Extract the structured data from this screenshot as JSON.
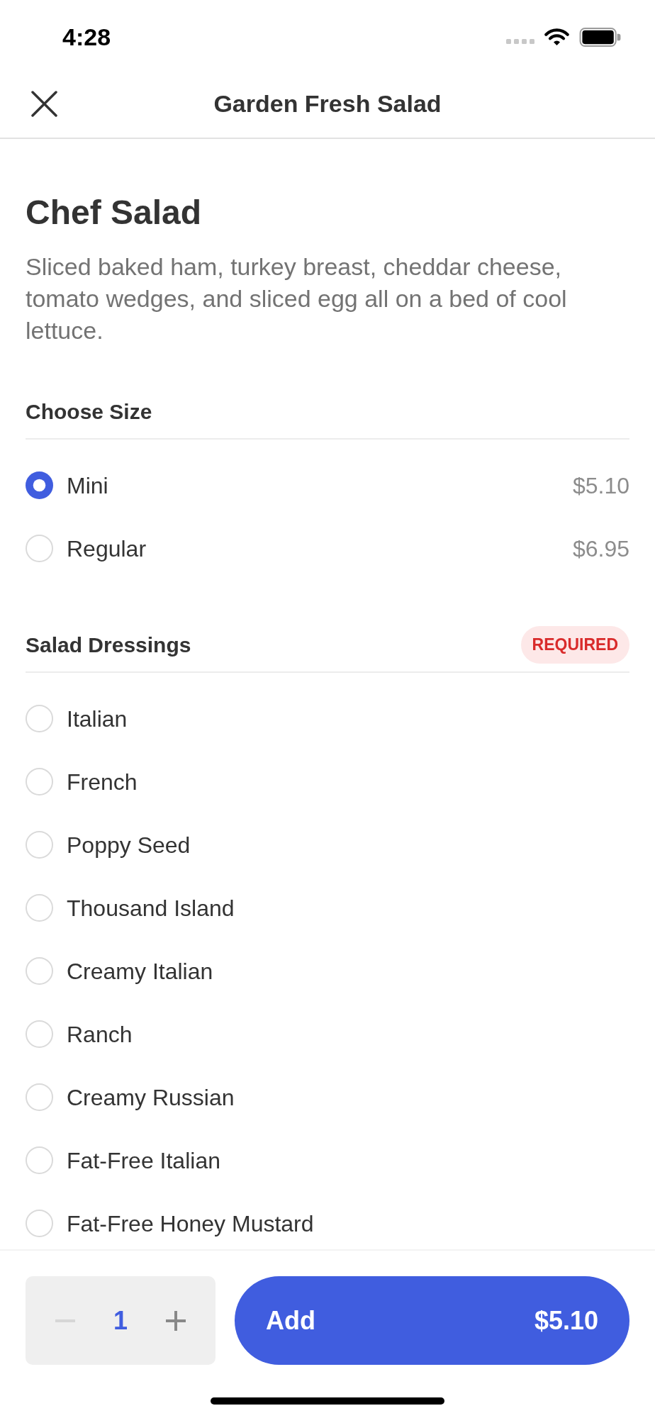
{
  "status_bar": {
    "time": "4:28"
  },
  "header": {
    "title": "Garden Fresh Salad"
  },
  "item": {
    "name": "Chef Salad",
    "description": "Sliced baked ham, turkey breast, cheddar cheese, tomato wedges, and sliced egg all on a bed of cool lettuce."
  },
  "option_groups": [
    {
      "title": "Choose Size",
      "options": [
        {
          "label": "Mini",
          "price": "$5.10",
          "selected": true
        },
        {
          "label": "Regular",
          "price": "$6.95",
          "selected": false
        }
      ]
    },
    {
      "title": "Salad Dressings",
      "badge": "REQUIRED",
      "options": [
        {
          "label": "Italian",
          "selected": false
        },
        {
          "label": "French",
          "selected": false
        },
        {
          "label": "Poppy Seed",
          "selected": false
        },
        {
          "label": "Thousand Island",
          "selected": false
        },
        {
          "label": "Creamy Italian",
          "selected": false
        },
        {
          "label": "Ranch",
          "selected": false
        },
        {
          "label": "Creamy Russian",
          "selected": false
        },
        {
          "label": "Fat-Free Italian",
          "selected": false
        },
        {
          "label": "Fat-Free Honey Mustard",
          "selected": false
        }
      ]
    }
  ],
  "footer": {
    "quantity": "1",
    "decrement_disabled": true,
    "add_button": {
      "label": "Add",
      "price": "$5.10"
    }
  }
}
